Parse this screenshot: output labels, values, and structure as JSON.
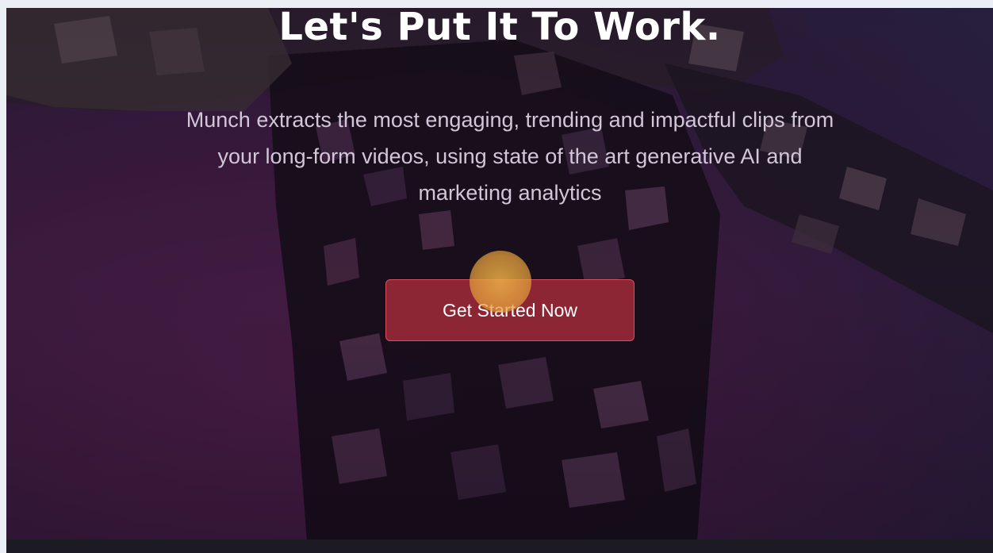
{
  "hero": {
    "headline": "Let's Put It To Work.",
    "subtext_lines": [
      "Munch extracts the most engaging, trending and impactful clips from",
      "your long-form videos, using state of the art generative AI and",
      "marketing analytics"
    ],
    "cta_label": "Get Started Now"
  },
  "colors": {
    "background": "#3a1a3e",
    "cta_fill": "#8c2634",
    "cta_border": "#d9505f",
    "headline": "#ffffff",
    "subtext": "#d2c6d8",
    "click_indicator": "#eeb048"
  }
}
